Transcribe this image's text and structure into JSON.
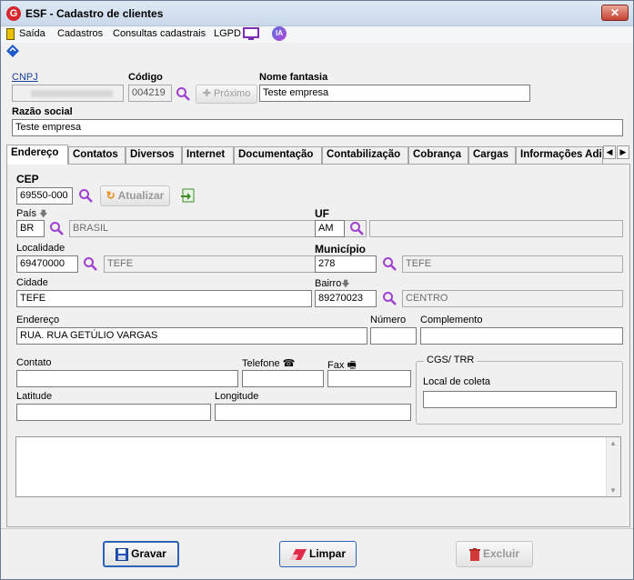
{
  "window": {
    "title": "ESF - Cadastro de clientes",
    "close_label": "✕"
  },
  "menu": {
    "items": [
      {
        "label": "Saída",
        "accel": "S"
      },
      {
        "label": "Cadastros",
        "accel": "C"
      },
      {
        "label": "Consultas cadastrais",
        "accel": ""
      },
      {
        "label": "LGPD",
        "accel": ""
      }
    ],
    "ia_label": "IA"
  },
  "header": {
    "cnpj_label": "CNPJ",
    "cnpj_value": "",
    "codigo_label": "Código",
    "codigo_value": "004219",
    "proximo_label": "Próximo",
    "nome_fantasia_label": "Nome fantasia",
    "nome_fantasia_value": "Teste empresa",
    "razao_social_label": "Razão social",
    "razao_social_value": "Teste empresa"
  },
  "tabs": [
    "Endereço",
    "Contatos",
    "Diversos",
    "Internet",
    "Documentação",
    "Contabilização",
    "Cobrança",
    "Cargas",
    "Informações Adi"
  ],
  "endereco": {
    "cep_label": "CEP",
    "cep_value": "69550-000",
    "atualizar_label": "Atualizar",
    "pais_label": "País",
    "pais_code": "BR",
    "pais_name": "BRASIL",
    "uf_label": "UF",
    "uf_code": "AM",
    "uf_name": "",
    "localidade_label": "Localidade",
    "localidade_code": "69470000",
    "localidade_name": "TEFE",
    "municipio_label": "Município",
    "municipio_code": "278",
    "municipio_name": "TEFE",
    "cidade_label": "Cidade",
    "cidade_value": "TEFE",
    "bairro_label": "Bairro",
    "bairro_code": "89270023",
    "bairro_name": "CENTRO",
    "endereco_label": "Endereço",
    "endereco_value": "RUA. RUA GETÚLIO VARGAS",
    "numero_label": "Número",
    "numero_value": "",
    "complemento_label": "Complemento",
    "complemento_value": "",
    "contato_label": "Contato",
    "contato_value": "",
    "telefone_label": "Telefone",
    "telefone_value": "",
    "fax_label": "Fax",
    "fax_value": "",
    "cgs_group_label": "CGS/ TRR",
    "local_coleta_label": "Local de coleta",
    "local_coleta_value": "",
    "latitude_label": "Latitude",
    "latitude_value": "",
    "longitude_label": "Longitude",
    "longitude_value": ""
  },
  "actions": {
    "gravar": "Gravar",
    "limpar": "Limpar",
    "excluir": "Excluir"
  },
  "colors": {
    "accent_blue": "#2b63b8",
    "magnifier": "#a040d0",
    "title_red": "#d7262e"
  }
}
